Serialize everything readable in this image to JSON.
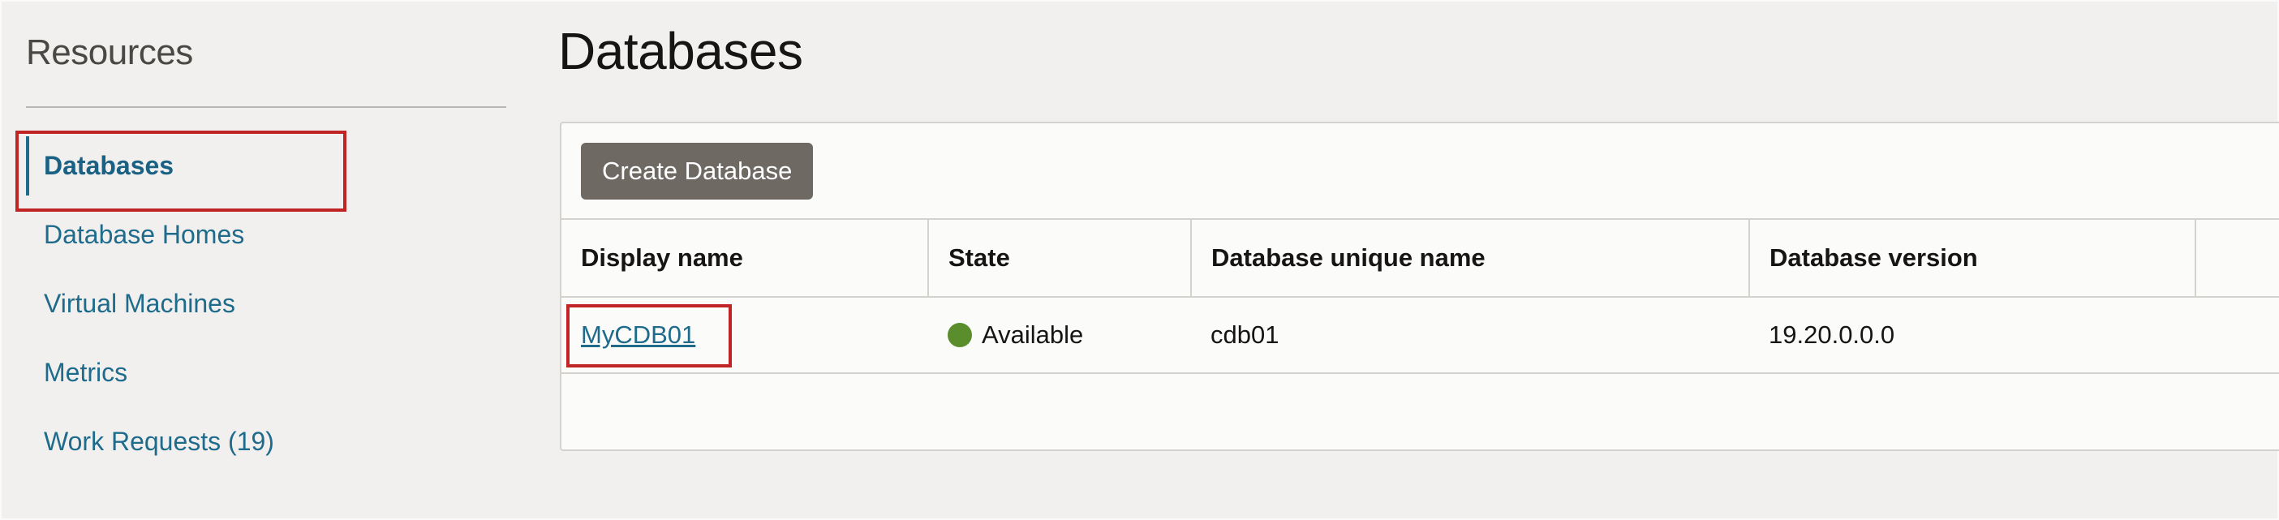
{
  "sidebar": {
    "title": "Resources",
    "items": [
      {
        "label": "Databases",
        "active": true
      },
      {
        "label": "Database Homes"
      },
      {
        "label": "Virtual Machines"
      },
      {
        "label": "Metrics"
      },
      {
        "label": "Work Requests (19)"
      }
    ]
  },
  "main": {
    "title": "Databases",
    "create_button": "Create Database",
    "table": {
      "columns": [
        "Display name",
        "State",
        "Database unique name",
        "Database version"
      ],
      "rows": [
        {
          "display_name": "MyCDB01",
          "state": "Available",
          "unique_name": "cdb01",
          "version": "19.20.0.0.0"
        }
      ]
    }
  },
  "colors": {
    "accent": "#1f6b8c",
    "highlight": "#c02425",
    "available": "#5a8d2c"
  }
}
